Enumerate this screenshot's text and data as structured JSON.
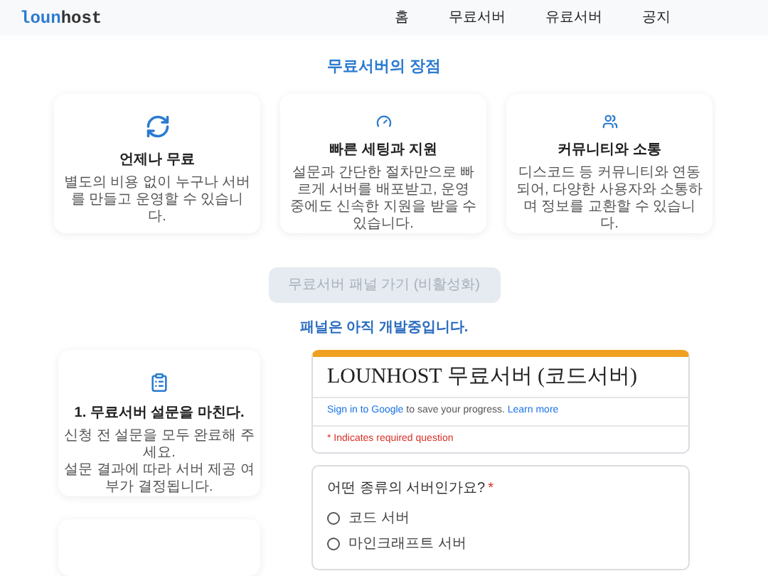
{
  "logo": {
    "part_1": "loun",
    "part_2": "host"
  },
  "nav": [
    {
      "label": "홈"
    },
    {
      "label": "무료서버"
    },
    {
      "label": "유료서버"
    },
    {
      "label": "공지"
    }
  ],
  "section_title": "무료서버의 장점",
  "features": [
    {
      "kind": "free",
      "title": "언제나 무료",
      "text": "별도의 비용 없이 누구나 서버를 만들고 운영할 수 있습니다."
    },
    {
      "kind": "speed",
      "title": "빠른 세팅과 지원",
      "text": "설문과 간단한 절차만으로 빠르게 서버를 배포받고, 운영 중에도 신속한 지원을 받을 수 있습니다."
    },
    {
      "kind": "community",
      "title": "커뮤니티와 소통",
      "text": "디스코드 등 커뮤니티와 연동되어, 다양한 사용자와 소통하며 정보를 교환할 수 있습니다."
    }
  ],
  "panel_button": {
    "label": "무료서버 패널 가기 (비활성화)",
    "disabled": true
  },
  "panel_notice": "패널은 아직 개발중입니다.",
  "steps": [
    {
      "title": "1. 무료서버 설문을 마친다.",
      "text": "신청 전 설문을 모두 완료해 주세요.\n설문 결과에 따라 서버 제공 여부가 결정됩니다."
    }
  ],
  "form": {
    "title": "LOUNHOST 무료서버 (코드서버)",
    "signin_link": "Sign in to Google",
    "signin_text": "to save your progress.",
    "learn_more": "Learn more",
    "required_note": "* Indicates required question",
    "question": "어떤 종류의 서버인가요?",
    "required_mark": "*",
    "options": [
      {
        "label": "코드 서버",
        "selected": false
      },
      {
        "label": "마인크래프트 서버",
        "selected": false
      }
    ]
  }
}
